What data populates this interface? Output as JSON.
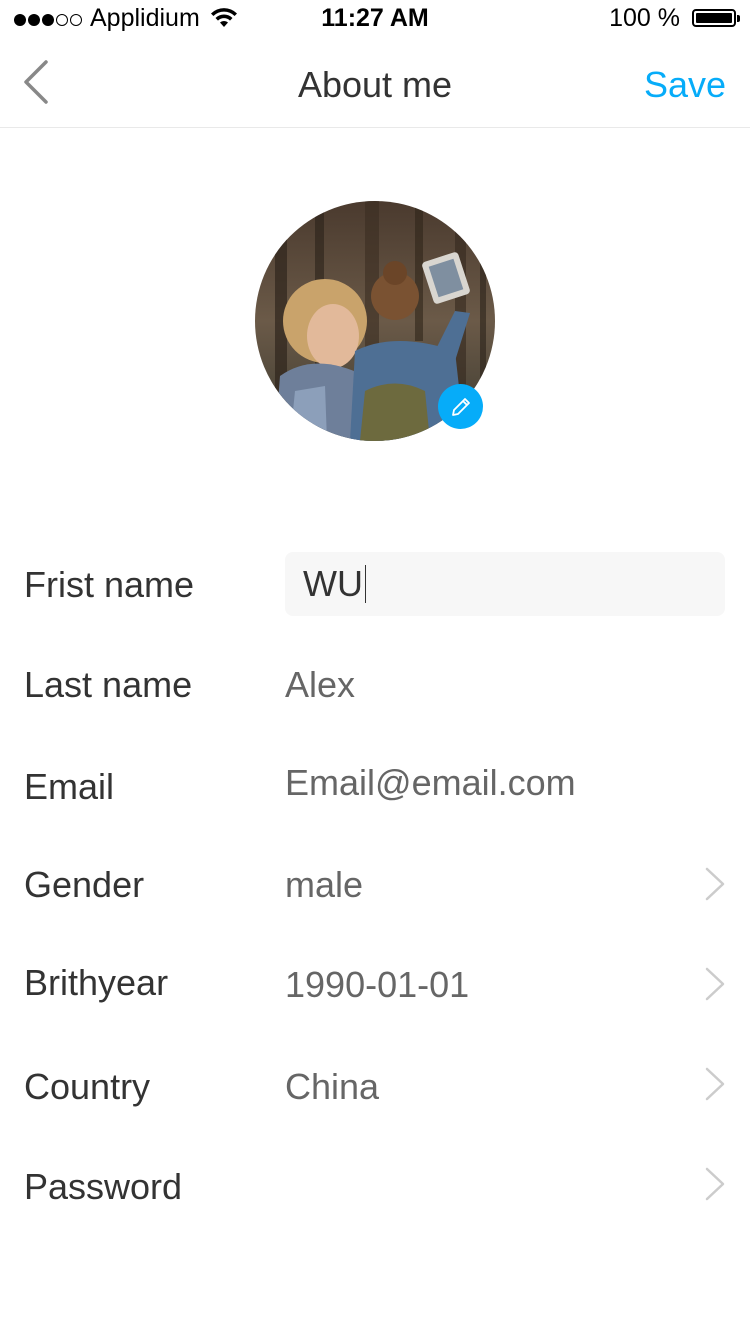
{
  "status_bar": {
    "carrier": "Applidium",
    "time": "11:27 AM",
    "battery": "100 %"
  },
  "nav": {
    "title": "About me",
    "save_label": "Save",
    "back_icon": "chevron-left-icon"
  },
  "avatar": {
    "edit_icon": "pencil-icon"
  },
  "form": {
    "first_name": {
      "label": "Frist name",
      "value": "WU"
    },
    "last_name": {
      "label": "Last name",
      "value": "Alex"
    },
    "email": {
      "label": "Email",
      "value": "Email@email.com"
    },
    "gender": {
      "label": "Gender",
      "value": "male"
    },
    "birthyear": {
      "label": "Brithyear",
      "value": "1990-01-01"
    },
    "country": {
      "label": "Country",
      "value": "China"
    },
    "password": {
      "label": "Password",
      "value": ""
    }
  },
  "colors": {
    "text_primary": "#333333",
    "text_secondary": "#666666",
    "accent": "#06acf9",
    "divider": "#e9e9e9",
    "input_bg": "#f7f7f7"
  }
}
